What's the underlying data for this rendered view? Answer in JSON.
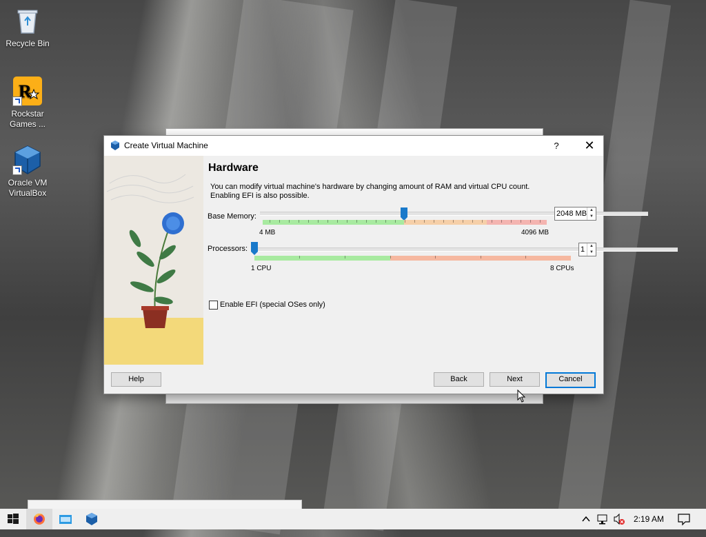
{
  "desktop": {
    "icons": [
      {
        "label": "Recycle Bin",
        "icon": "recycle-bin-icon"
      },
      {
        "label": "Rockstar Games ...",
        "icon": "rockstar-games-icon"
      },
      {
        "label": "Oracle VM VirtualBox",
        "icon": "virtualbox-icon"
      }
    ]
  },
  "dialog": {
    "title": "Create Virtual Machine",
    "help_glyph": "?",
    "close_glyph": "✕",
    "heading": "Hardware",
    "description": "You can modify virtual machine's hardware by changing amount of RAM and virtual CPU count. Enabling EFI is also possible.",
    "memory": {
      "label": "Base Memory:",
      "value": "2048 MB",
      "min_label": "4 MB",
      "max_label": "4096 MB",
      "min": 4,
      "max": 4096,
      "current": 2048
    },
    "processors": {
      "label": "Processors:",
      "value": "1",
      "min_label": "1 CPU",
      "max_label": "8 CPUs",
      "min": 1,
      "max": 8,
      "current": 1
    },
    "efi": {
      "label": "Enable EFI (special OSes only)",
      "checked": false
    },
    "buttons": {
      "help": "Help",
      "back": "Back",
      "next": "Next",
      "cancel": "Cancel"
    }
  },
  "taskbar": {
    "apps": [
      "windows-start-icon",
      "firefox-icon",
      "file-explorer-icon",
      "virtualbox-icon"
    ],
    "clock": "2:19 AM"
  },
  "colors": {
    "accent": "#0078d7",
    "slider_thumb": "#1979ca",
    "scale_good": "#9ee89e",
    "scale_warn": "#f5b8a0"
  }
}
